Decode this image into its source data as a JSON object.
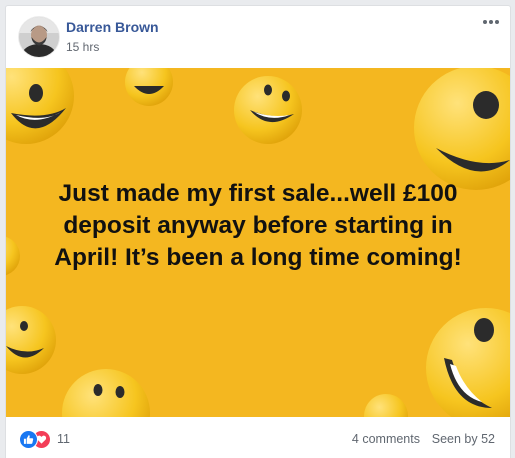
{
  "post": {
    "author": "Darren Brown",
    "time": "15 hrs",
    "text": "Just made my first sale...well £100 deposit anyway before starting in April! It’s been a long time coming!",
    "background_color": "#f4b720",
    "background_decor": "laughing-emoji-pattern"
  },
  "footer": {
    "reaction_icons": [
      "like-icon",
      "love-icon"
    ],
    "reaction_count": "11",
    "comments": "4 comments",
    "seen_by": "Seen by 52"
  },
  "colors": {
    "author_link": "#385898",
    "like": "#1877f2",
    "love": "#f33e58"
  },
  "icons": {
    "more": "more-options-icon",
    "avatar": "avatar"
  }
}
